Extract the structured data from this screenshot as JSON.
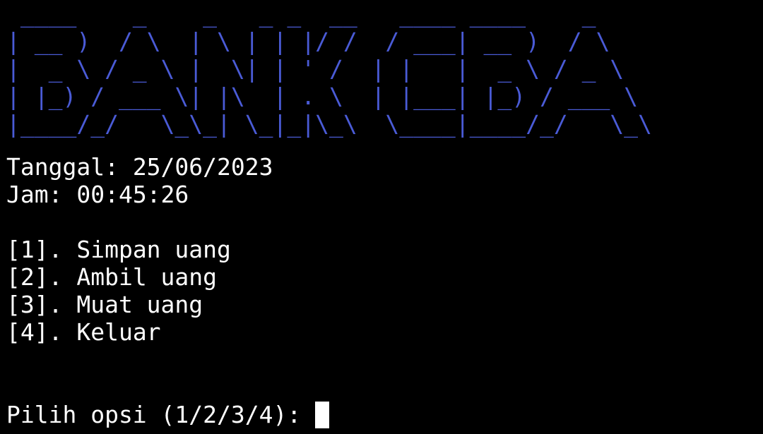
{
  "banner": {
    "lines": [
      " ____    _    _   _ _  __   ____ ____    _",
      "| __ )  / \\  | \\ | | |/ /  / ___| __ )  / \\",
      "|  _ \\ / _ \\ |  \\| | ' /  | |   |  _ \\ / _ \\",
      "| |_) / ___ \\| |\\  | . \\  | |___| |_) / ___ \\",
      "|____/_/   \\_\\_| \\_|_|\\_\\  \\____|____/_/   \\_\\"
    ],
    "color": "#4a5bd6"
  },
  "date": {
    "label": "Tanggal: ",
    "value": "25/06/2023"
  },
  "time": {
    "label": "Jam: ",
    "value": "00:45:26"
  },
  "menu": [
    {
      "key": "[1]. ",
      "label": "Simpan uang"
    },
    {
      "key": "[2]. ",
      "label": "Ambil uang"
    },
    {
      "key": "[3]. ",
      "label": "Muat uang"
    },
    {
      "key": "[4]. ",
      "label": "Keluar"
    }
  ],
  "prompt": {
    "text": "Pilih opsi (1/2/3/4): "
  }
}
